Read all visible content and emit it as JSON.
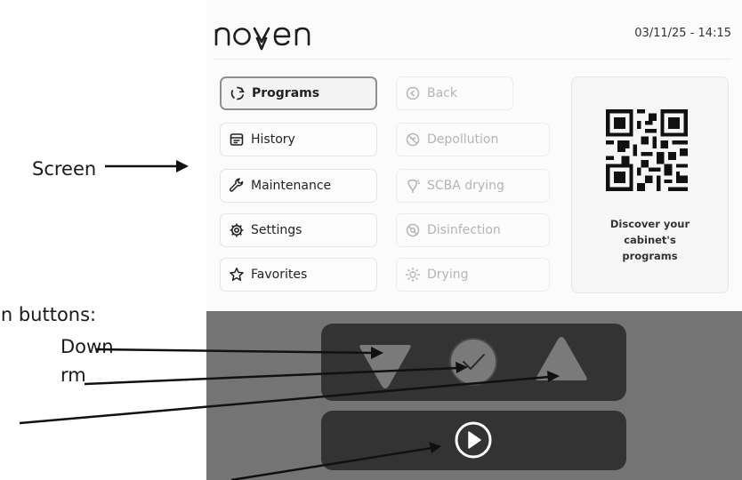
{
  "annotations": {
    "screen": "Screen",
    "nav_buttons": "on buttons:",
    "down": "Down",
    "confirm": "rm"
  },
  "header": {
    "logo_text": "noyen",
    "datetime": "03/11/25 - 14:15"
  },
  "menu": [
    {
      "label": "Programs",
      "icon": "programs-icon",
      "selected": true
    },
    {
      "label": "History",
      "icon": "history-icon",
      "selected": false
    },
    {
      "label": "Maintenance",
      "icon": "wrench-icon",
      "selected": false
    },
    {
      "label": "Settings",
      "icon": "gear-icon",
      "selected": false
    },
    {
      "label": "Favorites",
      "icon": "star-icon",
      "selected": false
    }
  ],
  "programs": [
    {
      "label": "Back",
      "icon": "back-icon",
      "enabled": false
    },
    {
      "label": "Depollution",
      "icon": "depollution-icon",
      "enabled": false
    },
    {
      "label": "SCBA drying",
      "icon": "scba-icon",
      "enabled": false
    },
    {
      "label": "Disinfection",
      "icon": "disinfection-icon",
      "enabled": false
    },
    {
      "label": "Drying",
      "icon": "sun-icon",
      "enabled": false
    }
  ],
  "qr_card": {
    "caption": "Discover your\ncabinet's\nprograms"
  },
  "controls": {
    "down": "triangle-down-icon",
    "confirm": "check-circle-icon",
    "up": "triangle-up-icon",
    "start": "play-circle-icon"
  },
  "colors": {
    "panel": "#747474",
    "pad": "#333333",
    "selected_border": "#8f8f8f",
    "disabled_text": "#b4b4b4"
  }
}
